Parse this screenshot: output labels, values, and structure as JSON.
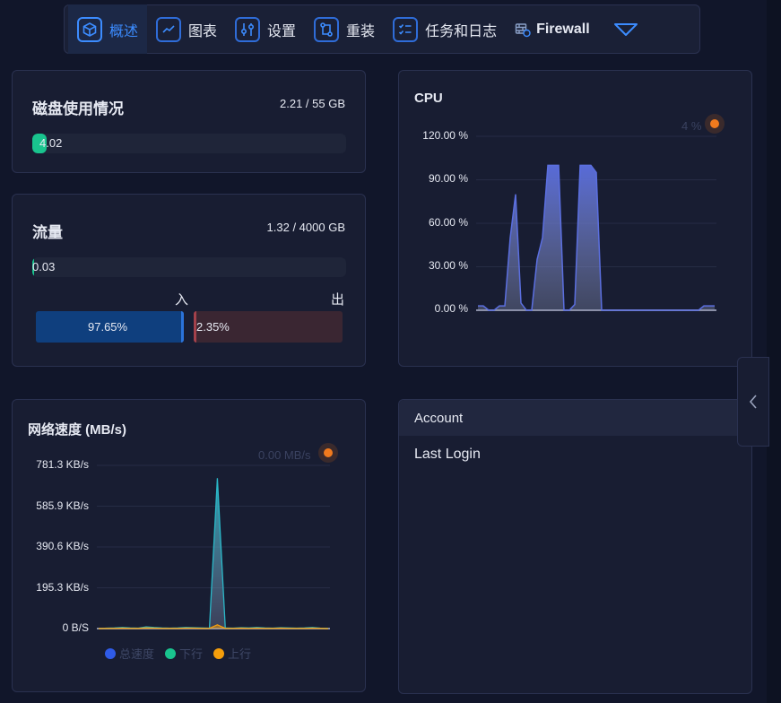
{
  "nav": {
    "items": [
      {
        "label": "概述",
        "icon": "cube-icon",
        "active": true
      },
      {
        "label": "图表",
        "icon": "line-chart-icon"
      },
      {
        "label": "设置",
        "icon": "sliders-icon"
      },
      {
        "label": "重装",
        "icon": "reinstall-icon"
      },
      {
        "label": "任务和日志",
        "icon": "checklist-icon"
      },
      {
        "label": "Firewall",
        "icon": "firewall-icon"
      }
    ],
    "expand_icon": "chevron-down-icon"
  },
  "disk": {
    "title": "磁盘使用情况",
    "value": "2.21 / 55 GB",
    "bar_text": "4.02",
    "percent": 4.02
  },
  "traffic": {
    "title": "流量",
    "value": "1.32 / 4000 GB",
    "bar_text": "0.03",
    "percent": 0.03,
    "in_label": "入",
    "out_label": "出",
    "in_percent_text": "97.65%",
    "out_percent_text": "2.35%",
    "in_percent": 97.65,
    "out_percent": 2.35
  },
  "cpu": {
    "title": "CPU",
    "live_value": "4 %",
    "chart_data": {
      "type": "area",
      "title": "CPU",
      "yticks": [
        "120.00 %",
        "90.00 %",
        "60.00 %",
        "30.00 %",
        "0.00 %"
      ],
      "ylim": [
        0,
        120
      ],
      "grid": true,
      "series": [
        {
          "color": "#5b6fe0",
          "values": [
            3,
            3,
            0,
            0,
            3,
            3,
            50,
            80,
            5,
            0,
            0,
            35,
            50,
            100,
            100,
            100,
            0,
            0,
            4,
            100,
            100,
            100,
            95,
            0,
            0,
            0,
            0,
            0,
            0,
            0,
            0,
            0,
            0,
            0,
            0,
            0,
            0,
            0,
            0,
            0,
            0,
            0,
            3,
            3,
            3
          ]
        }
      ]
    }
  },
  "network": {
    "title": "网络速度 (MB/s)",
    "live_value": "0.00 MB/s",
    "legend": [
      {
        "label": "总速度",
        "color": "#2f5be8"
      },
      {
        "label": "下行",
        "color": "#19c48e"
      },
      {
        "label": "上行",
        "color": "#f59e0b"
      }
    ],
    "chart_data": {
      "type": "line",
      "title": "网络速度 (MB/s)",
      "yticks": [
        "781.3 KB/s",
        "585.9 KB/s",
        "390.6 KB/s",
        "195.3 KB/s",
        "0 B/S"
      ],
      "ylim": [
        0,
        781.3
      ],
      "grid": true,
      "series": [
        {
          "name": "下行",
          "color": "#2ab8c8",
          "values": [
            0,
            2,
            3,
            5,
            3,
            2,
            8,
            5,
            3,
            2,
            3,
            5,
            4,
            3,
            2,
            720,
            3,
            2,
            4,
            3,
            5,
            3,
            2,
            4,
            3,
            2,
            3,
            5,
            2,
            1
          ]
        },
        {
          "name": "上行",
          "color": "#f59e0b",
          "values": [
            0,
            1,
            1,
            2,
            1,
            1,
            3,
            2,
            1,
            1,
            1,
            2,
            2,
            1,
            1,
            18,
            1,
            1,
            2,
            1,
            2,
            1,
            1,
            2,
            1,
            1,
            1,
            2,
            1,
            0
          ]
        }
      ]
    }
  },
  "account": {
    "title": "Account",
    "last_login_label": "Last Login"
  },
  "colors": {
    "accent": "#3c8cff",
    "disk_fill": "#19c48e",
    "traffic_in": "#0f3f7e",
    "traffic_out": "#3a2632"
  }
}
